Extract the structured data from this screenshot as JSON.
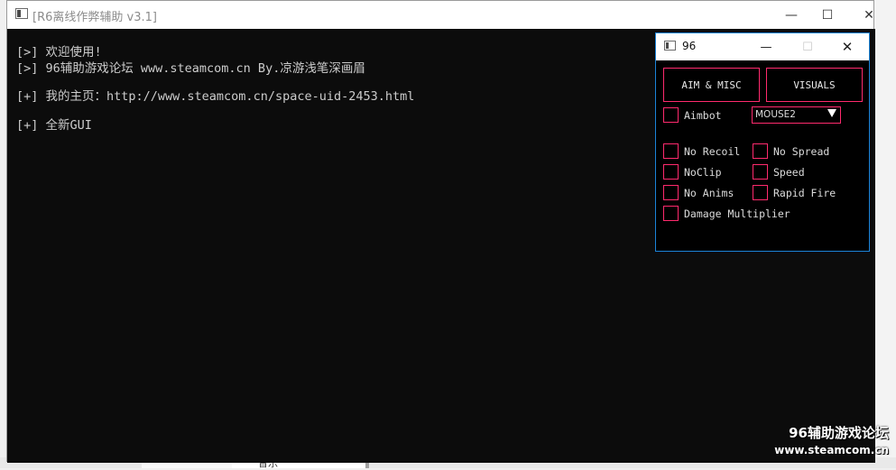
{
  "console": {
    "title": "[R6离线作弊辅助 v3.1]",
    "controls": {
      "minimize": "—",
      "maximize": "☐",
      "close": "✕"
    },
    "lines": [
      "[>] 欢迎使用!",
      "[>] 96辅助游戏论坛 www.steamcom.cn By.凉游浅笔深画眉",
      "[+] 我的主页：http://www.steamcom.cn/space-uid-2453.html",
      "[+] 全新GUI"
    ]
  },
  "gui": {
    "title": "96",
    "controls": {
      "minimize": "—",
      "maximize": "☐",
      "close": "✕"
    },
    "tabs": [
      "AIM & MISC",
      "VISUALS"
    ],
    "aimbot_label": "Aimbot",
    "aimbot_key": "MOUSE2",
    "options": {
      "no_recoil": "No Recoil",
      "no_spread": "No Spread",
      "noclip": "NoClip",
      "speed": "Speed",
      "no_anims": "No Anims",
      "rapid_fire": "Rapid Fire",
      "damage_multiplier": "Damage Multiplier"
    },
    "accent_color": "#ff2a6d"
  },
  "watermark": {
    "line1": "96辅助游戏论坛",
    "line2": "www.steamcom.cn"
  },
  "background": {
    "partial_text": "音乐"
  }
}
